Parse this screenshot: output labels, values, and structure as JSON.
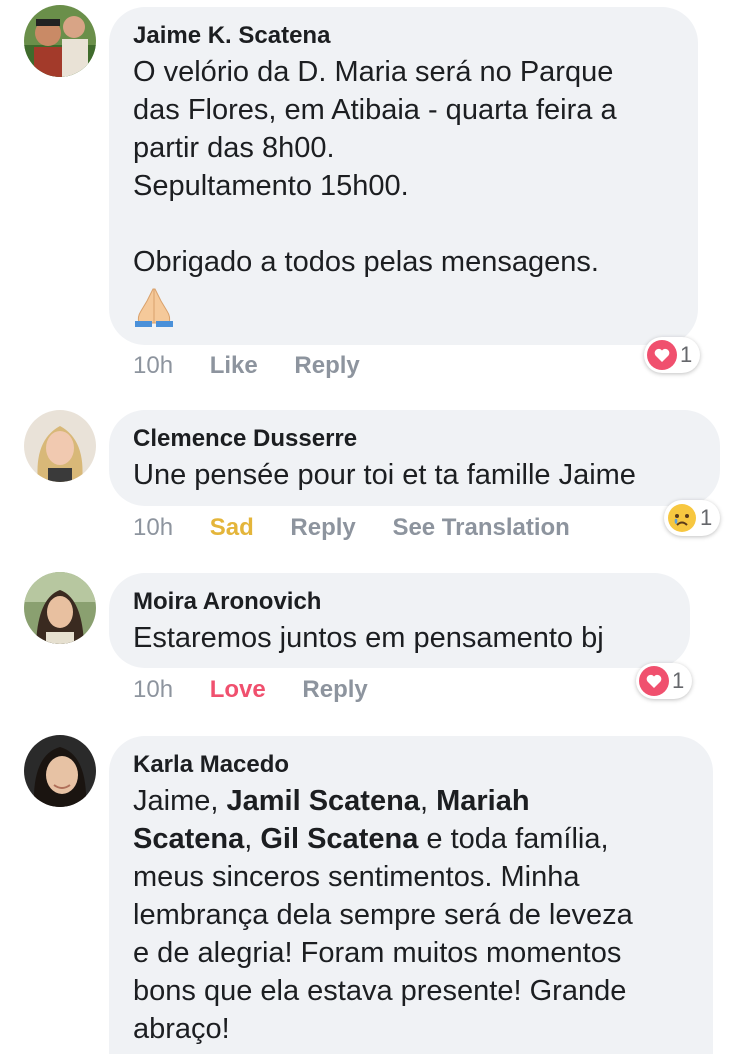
{
  "comments": [
    {
      "author": "Jaime K. Scatena",
      "lines": [
        "O velório da D. Maria será no Parque",
        "das Flores, em Atibaia - quarta feira a",
        "partir das 8h00.",
        "Sepultamento 15h00.",
        "",
        "Obrigado a todos pelas mensagens."
      ],
      "emoji": "folded-hands-emoji",
      "time": "10h",
      "reaction_label": "Like",
      "reply_label": "Reply",
      "reaction_icon": "heart-icon",
      "reaction_count": "1"
    },
    {
      "author": "Clemence Dusserre",
      "lines": [
        "Une pensée pour toi et ta famille Jaime"
      ],
      "time": "10h",
      "reaction_label": "Sad",
      "reply_label": "Reply",
      "translation_label": "See Translation",
      "reaction_icon": "sad-icon",
      "reaction_count": "1"
    },
    {
      "author": "Moira Aronovich",
      "lines": [
        "Estaremos juntos em pensamento  bj"
      ],
      "time": "10h",
      "reaction_label": "Love",
      "reply_label": "Reply",
      "reaction_icon": "heart-icon",
      "reaction_count": "1"
    },
    {
      "author": "Karla Macedo",
      "text_parts": {
        "l1_a": "Jaime, ",
        "l1_b": "Jamil Scatena",
        "l1_c": ", ",
        "l1_d": "Mariah",
        "l2_a": "Scatena",
        "l2_b": ", ",
        "l2_c": "Gil Scatena",
        "l2_d": " e toda família,",
        "l3": "meus sinceros sentimentos. Minha",
        "l4": "lembrança dela sempre será de leveza",
        "l5": "e de alegria!  Foram muitos momentos",
        "l6": "bons que ela estava presente!  Grande",
        "l7": "abraço!"
      }
    }
  ],
  "colors": {
    "bubble": "#f0f2f5",
    "meta": "#8d949e",
    "sad": "#e4b53a",
    "love": "#f0506e",
    "heart_badge": "#f0506e"
  }
}
